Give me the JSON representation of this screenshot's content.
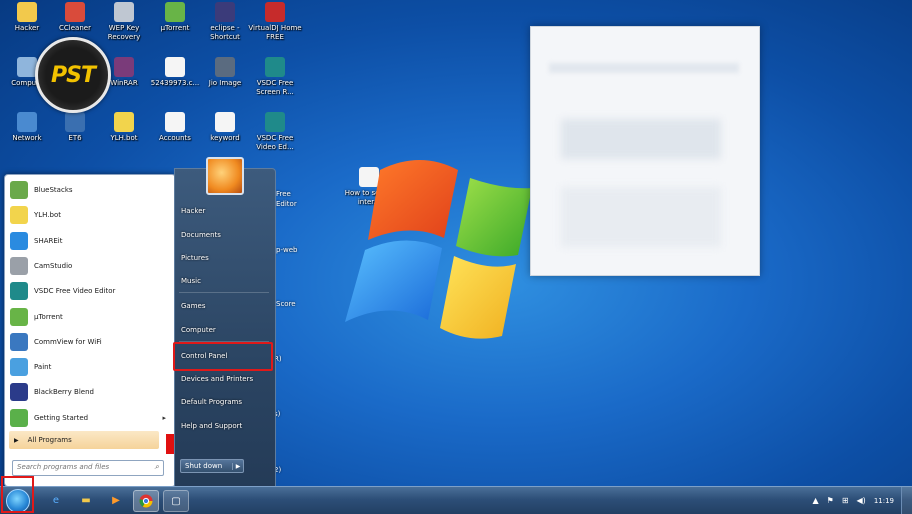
{
  "desktop": {
    "icons": [
      {
        "label": "Hacker",
        "color": "#f2c94c"
      },
      {
        "label": "CCleaner",
        "color": "#d94b3b"
      },
      {
        "label": "WEP Key Recovery",
        "color": "#bfc7d2"
      },
      {
        "label": "µTorrent",
        "color": "#68b447"
      },
      {
        "label": "eclipse - Shortcut",
        "color": "#3b3b7a"
      },
      {
        "label": "VirtualDJ Home FREE",
        "color": "#c62b2b"
      },
      {
        "label": "Compu...",
        "color": "#8fb5dc"
      },
      {
        "label": "WinRAR",
        "color": "#7a3b7a"
      },
      {
        "label": "52439973.c...",
        "color": "#f5f5f5"
      },
      {
        "label": "Jio Image",
        "color": "#5a6b80"
      },
      {
        "label": "VSDC Free Screen R...",
        "color": "#1f8a8a"
      },
      {
        "label": "Network",
        "color": "#4a8ad0"
      },
      {
        "label": "ET6",
        "color": "#3a6fb0"
      },
      {
        "label": "YLH.bot",
        "color": "#f2d44c"
      },
      {
        "label": "Accounts",
        "color": "#f5f5f5"
      },
      {
        "label": "keyword",
        "color": "#f5f5f5"
      },
      {
        "label": "VSDC Free Video Ed...",
        "color": "#1f8a8a"
      },
      {
        "label": "How to set up inter...",
        "color": "#f5f5f5"
      }
    ],
    "partial_labels": [
      "Free",
      "Editor",
      "p-web",
      "Score",
      "R)",
      "s)",
      "2)"
    ]
  },
  "logo": {
    "text": "PST"
  },
  "start_menu": {
    "pinned": [
      {
        "label": "BlueStacks",
        "icon": "bluestacks-icon",
        "color": "#6aa94a"
      },
      {
        "label": "YLH.bot",
        "icon": "smiley-icon",
        "color": "#f2d44c"
      },
      {
        "label": "SHAREit",
        "icon": "shareit-icon",
        "color": "#2a8be0"
      },
      {
        "label": "CamStudio",
        "icon": "camstudio-icon",
        "color": "#9aa0a8"
      },
      {
        "label": "VSDC Free Video Editor",
        "icon": "vsdc-icon",
        "color": "#1f8a8a"
      },
      {
        "label": "µTorrent",
        "icon": "utorrent-icon",
        "color": "#68b447"
      },
      {
        "label": "CommView for WiFi",
        "icon": "commview-icon",
        "color": "#3a78c0"
      },
      {
        "label": "Paint",
        "icon": "paint-icon",
        "color": "#4aa0e0"
      },
      {
        "label": "BlackBerry Blend",
        "icon": "blackberry-icon",
        "color": "#2b3b8a"
      },
      {
        "label": "Getting Started",
        "icon": "getting-started-icon",
        "color": "#5ab04a"
      }
    ],
    "all_programs": "All Programs",
    "search_placeholder": "Search programs and files",
    "right_items": [
      "Hacker",
      "Documents",
      "Pictures",
      "Music",
      "Games",
      "Computer",
      "Control Panel",
      "Devices and Printers",
      "Default Programs",
      "Help and Support"
    ],
    "shutdown": "Shut down"
  },
  "taskbar": {
    "clock": "11:19",
    "pinned_apps": [
      "internet-explorer-icon",
      "explorer-folder-icon",
      "media-player-icon",
      "chrome-icon",
      "window-icon"
    ]
  },
  "colors": {
    "highlight": "#e01919"
  }
}
